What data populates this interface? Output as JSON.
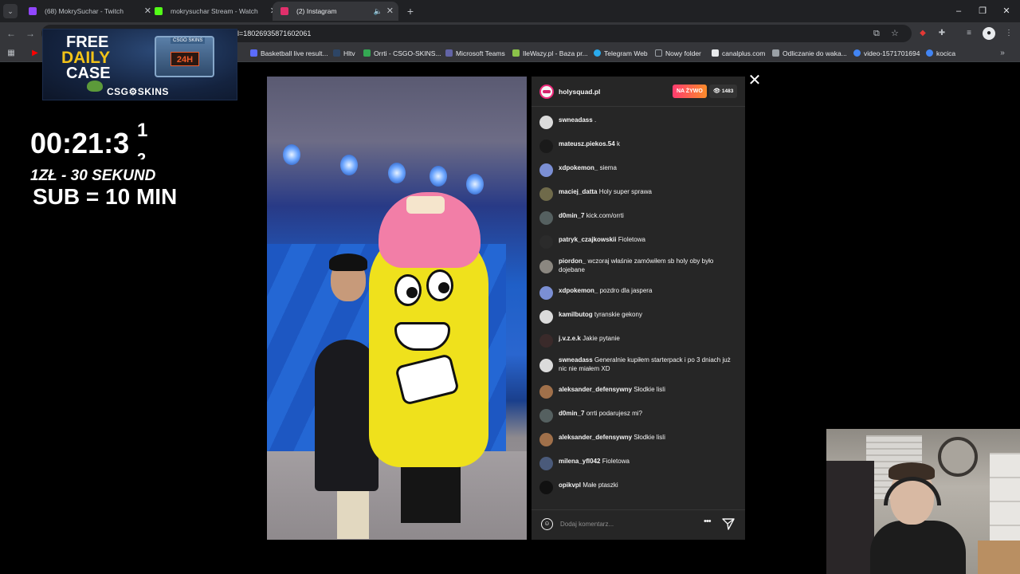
{
  "browser": {
    "tabs": [
      {
        "title": "(68) MokrySuchar - Twitch",
        "favicon_color": "#9146ff",
        "active": false
      },
      {
        "title": "mokrysuchar Stream - Watch Li",
        "favicon_color": "#53fc18",
        "active": false
      },
      {
        "title": "(2) Instagram",
        "favicon_color": "#e1306c",
        "active": true
      }
    ],
    "url": "l=18026935871602061",
    "bookmarks": [
      {
        "label": "Basketball live result...",
        "color": "#5b6cff"
      },
      {
        "label": "Hltv",
        "color": "#2d4565"
      },
      {
        "label": "Orrti - CSGO-SKINS...",
        "color": "#34a853"
      },
      {
        "label": "Microsoft Teams",
        "color": "#6264a7"
      },
      {
        "label": "IleWazy.pl - Baza pr...",
        "color": "#8bc34a"
      },
      {
        "label": "Telegram Web",
        "color": "#2aabee"
      },
      {
        "label": "Nowy folder",
        "color": "#9aa0a6"
      },
      {
        "label": "canalplus.com",
        "color": "#e8eaed"
      },
      {
        "label": "Odliczanie do waka...",
        "color": "#9aa0a6"
      },
      {
        "label": "video-1571701694",
        "color": "#4285f4"
      },
      {
        "label": "kocica",
        "color": "#4285f4"
      }
    ]
  },
  "overlay": {
    "promo": {
      "line1": "FREE",
      "line2": "DAILY",
      "line3": "CASE",
      "brand": "CSG⚙SKINS",
      "tag": "24H"
    },
    "timer": "00:21:3",
    "timer_sup": "1",
    "timer_sub": "2",
    "rate": "1ZŁ - 30 SEKUND",
    "sub": "SUB = 10 MIN"
  },
  "instagram": {
    "host": "holysquad.pl",
    "live_badge": "NA ŻYWO",
    "viewers": "1483",
    "comments": [
      {
        "user": "swneadass",
        "text": ".",
        "avatar": "#dbdbdb"
      },
      {
        "user": "mateusz.piekos.54",
        "text": "k",
        "avatar": "#1a1a1a"
      },
      {
        "user": "xdpokemon_",
        "text": "siema",
        "avatar": "#7b8fd4"
      },
      {
        "user": "maciej_datta",
        "text": "Holy super sprawa",
        "avatar": "#6f6a4a"
      },
      {
        "user": "d0min_7",
        "text": "kick.com/orrti",
        "avatar": "#556060"
      },
      {
        "user": "patryk_czajkowskii",
        "text": "Fioletowa",
        "avatar": "#2b2b2b"
      },
      {
        "user": "piordon_",
        "text": "wczoraj właśnie zamówiłem sb holy oby było dojebane",
        "avatar": "#8b8780"
      },
      {
        "user": "xdpokemon_",
        "text": "pozdro dla jaspera",
        "avatar": "#7b8fd4"
      },
      {
        "user": "kamilbutog",
        "text": "tyranskie gekony",
        "avatar": "#dbdbdb"
      },
      {
        "user": "j.v.z.e.k",
        "text": "Jakie pytanie",
        "avatar": "#3a2a2a"
      },
      {
        "user": "swneadass",
        "text": "Generalnie kupiłem starterpack i po 3 dniach już nic nie miałem XD",
        "avatar": "#dbdbdb"
      },
      {
        "user": "aleksander_defensywny",
        "text": "Słodkie lisli",
        "avatar": "#a0704a"
      },
      {
        "user": "d0min_7",
        "text": "orrti podarujesz mi?",
        "avatar": "#556060"
      },
      {
        "user": "aleksander_defensywny",
        "text": "Słodkie lisli",
        "avatar": "#a0704a"
      },
      {
        "user": "milena_yfl042",
        "text": "Fioletowa",
        "avatar": "#4a5a7a"
      },
      {
        "user": "opikvpl",
        "text": "Małe ptaszki",
        "avatar": "#111111"
      }
    ],
    "comment_placeholder": "Dodaj komentarz..."
  }
}
